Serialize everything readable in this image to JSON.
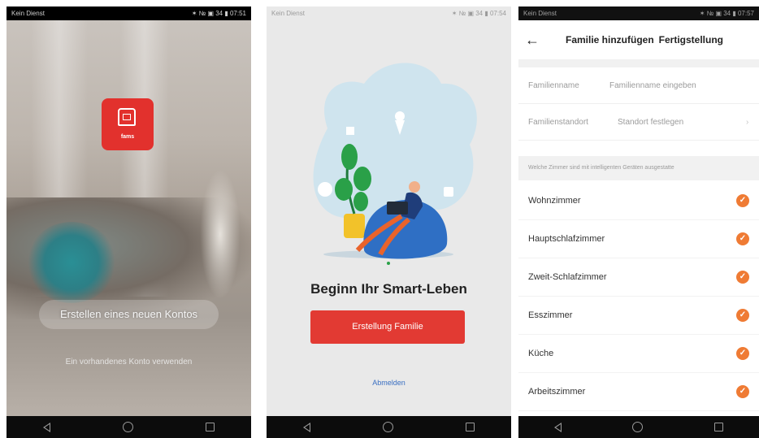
{
  "phone1": {
    "status_left": "Kein Dienst",
    "status_right": "✶ № ▣ 34 ▮ 07:51",
    "logo_text": "fams",
    "create_account": "Erstellen eines neuen Kontos",
    "use_existing": "Ein vorhandenes Konto verwenden"
  },
  "phone2": {
    "status_left": "Kein Dienst",
    "status_right": "✶ № ▣ 34 ▮ 07:54",
    "title": "Beginn Ihr Smart-Leben",
    "create_family": "Erstellung Familie",
    "logout": "Abmelden"
  },
  "phone3": {
    "status_left": "Kein Dienst",
    "status_right": "✶ № ▣ 34 ▮ 07:57",
    "title": "Familie hinzufügen",
    "done": "Fertigstellung",
    "family_name_label": "Familienname",
    "family_name_placeholder": "Familienname eingeben",
    "location_label": "Familienstandort",
    "location_placeholder": "Standort festlegen",
    "hint": "Welche Zimmer sind mit intelligenten Geräten ausgestatte",
    "rooms": [
      "Wohnzimmer",
      "Hauptschlafzimmer",
      "Zweit-Schlafzimmer",
      "Esszimmer",
      "Küche",
      "Arbeitszimmer"
    ]
  },
  "colors": {
    "brand_red": "#e23a33",
    "check_orange": "#ef7b34",
    "link_blue": "#3a6fc2"
  }
}
